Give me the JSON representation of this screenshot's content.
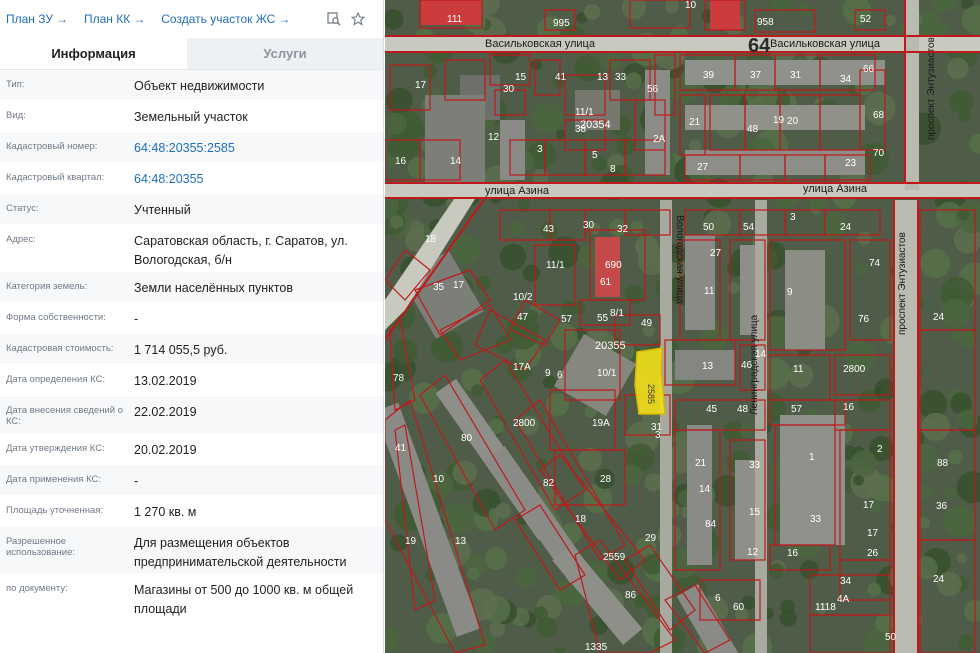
{
  "topbar": {
    "links": [
      {
        "label": "План ЗУ",
        "arrow": "→"
      },
      {
        "label": "План КК",
        "arrow": "→"
      },
      {
        "label": "Создать участок ЖС",
        "arrow": "→"
      }
    ],
    "icons": [
      "search-layer-icon",
      "star-icon"
    ]
  },
  "tabs": [
    {
      "label": "Информация",
      "active": true
    },
    {
      "label": "Услуги",
      "active": false
    }
  ],
  "info": [
    {
      "label": "Тип:",
      "value": "Объект недвижимости"
    },
    {
      "label": "Вид:",
      "value": "Земельный участок"
    },
    {
      "label": "Кадастровый номер:",
      "value": "64:48:20355:2585",
      "link": true
    },
    {
      "label": "Кадастровый квартал:",
      "value": "64:48:20355",
      "link": true
    },
    {
      "label": "Статус:",
      "value": "Учтенный"
    },
    {
      "label": "Адрес:",
      "value": "Саратовская область, г. Саратов, ул. Вологодская, б/н"
    },
    {
      "label": "Категория земель:",
      "value": "Земли населённых пунктов"
    },
    {
      "label": "Форма собственности:",
      "value": "-"
    },
    {
      "label": "Кадастровая стоимость:",
      "value": "1 714 055,5 руб."
    },
    {
      "label": "Дата определения КС:",
      "value": "13.02.2019"
    },
    {
      "label": "Дата внесения сведений о КС:",
      "value": "22.02.2019"
    },
    {
      "label": "Дата утверждения КС:",
      "value": "20.02.2019"
    },
    {
      "label": "Дата применения КС:",
      "value": "-"
    },
    {
      "label": "Площадь уточненная:",
      "value": "1 270 кв. м"
    },
    {
      "label": "Разрешенное использование:",
      "value": "Для размещения объектов предпринимательской деятельности"
    },
    {
      "label": "по документу:",
      "value": "Магазины от 500 до 1000 кв. м общей площади"
    }
  ],
  "map": {
    "streets": {
      "vasilkovskaya_1": "Васильковская улица",
      "vasilkovskaya_2": "Васильковская улица",
      "azina_1": "улица Азина",
      "azina_2": "улица Азина",
      "vologodskaya": "Вологодская улица",
      "leningradskaya": "Ленинградская улица",
      "entuziastov_1": "проспект Энтузиастов",
      "entuziastov_2": "проспект Энтузиастов"
    },
    "region_code": "64",
    "quarter_label_1": "20354",
    "quarter_label_2": "20355",
    "selected_parcel": "2585",
    "parcel_numbers": [
      "111",
      "995",
      "10",
      "958",
      "52",
      "15",
      "41",
      "13",
      "33",
      "30",
      "56",
      "39",
      "37",
      "31",
      "34",
      "66",
      "17",
      "11/1",
      "38",
      "2A",
      "21",
      "48",
      "19",
      "20",
      "68",
      "16",
      "14",
      "12",
      "3",
      "5",
      "8",
      "27",
      "23",
      "70",
      "18",
      "43",
      "30",
      "32",
      "50",
      "54",
      "3",
      "24",
      "61",
      "11/1",
      "690",
      "57",
      "27",
      "11",
      "9",
      "74",
      "35",
      "17",
      "10/2",
      "47",
      "55",
      "8/1",
      "49",
      "76",
      "17A",
      "9",
      "6",
      "10/1",
      "13",
      "46",
      "14",
      "11",
      "2800",
      "78",
      "3",
      "45",
      "48",
      "57",
      "16",
      "2800",
      "80",
      "19A",
      "31",
      "2",
      "41",
      "10",
      "82",
      "28",
      "21",
      "33",
      "1",
      "19",
      "13",
      "18",
      "14",
      "15",
      "33",
      "17",
      "29",
      "17",
      "84",
      "12",
      "16",
      "26",
      "2559",
      "86",
      "6",
      "60",
      "34",
      "4A",
      "88",
      "36",
      "24",
      "24",
      "1118",
      "1335",
      "50",
      "10",
      "26"
    ]
  },
  "colors": {
    "link": "#1f6fb8",
    "parcel_border": "#c0181b",
    "selected_parcel": "#f5e11b"
  }
}
